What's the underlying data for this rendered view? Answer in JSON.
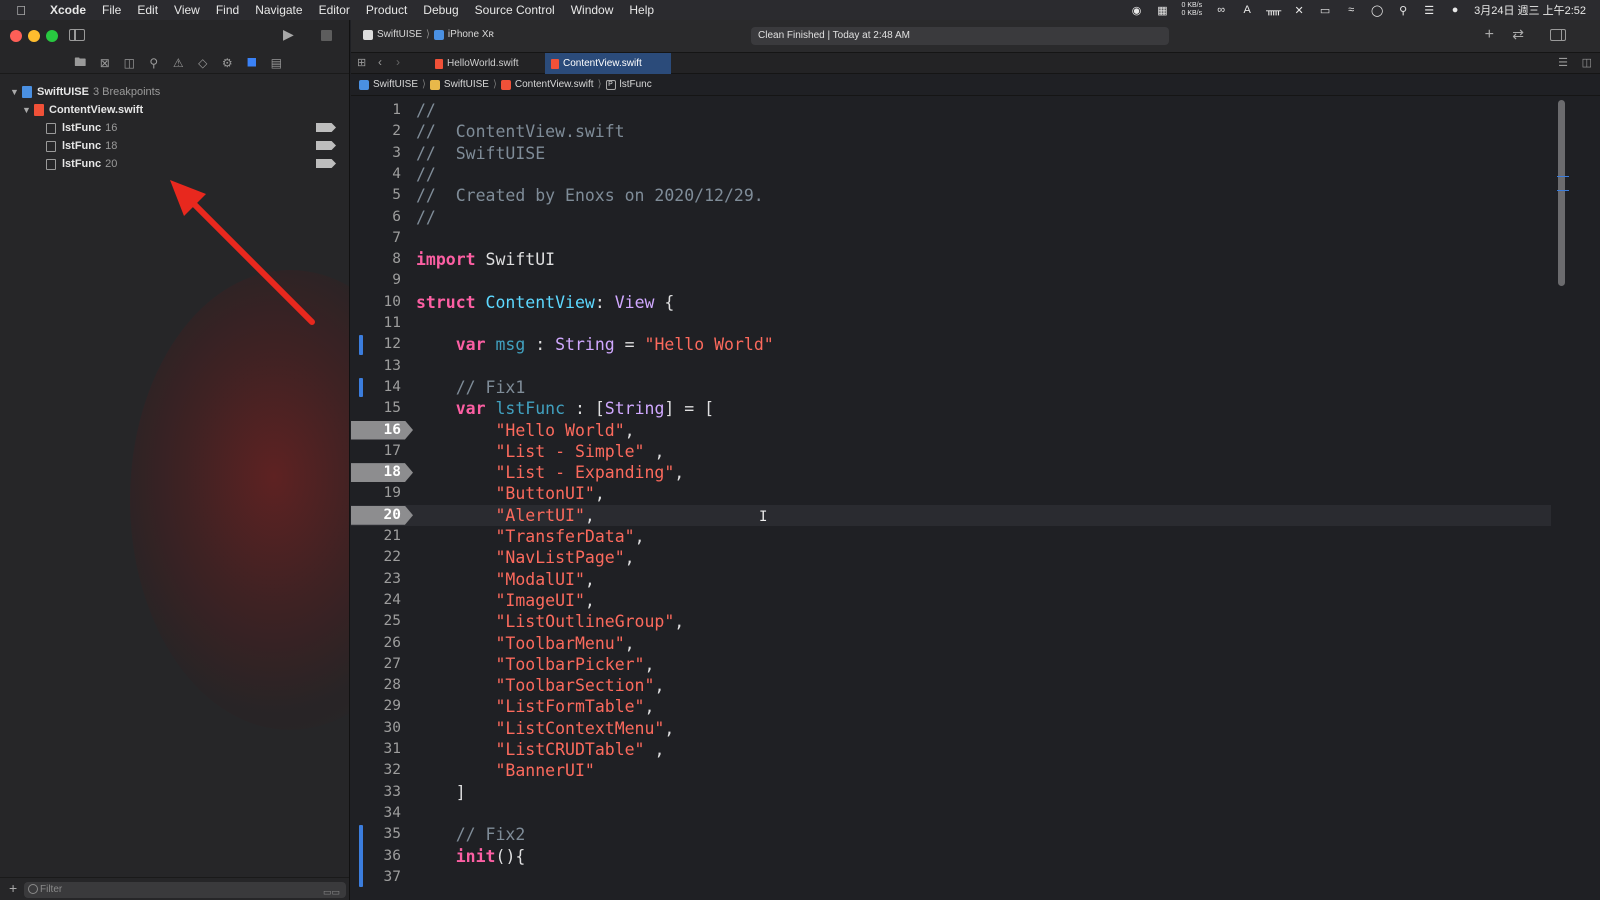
{
  "menubar": {
    "app": "Xcode",
    "items": [
      "File",
      "Edit",
      "View",
      "Find",
      "Navigate",
      "Editor",
      "Product",
      "Debug",
      "Source Control",
      "Window",
      "Help"
    ],
    "net_up": "0 KB/s",
    "net_down": "0 KB/s",
    "clock": "3月24日 週三 上午2:52"
  },
  "navigator": {
    "project": "SwiftUISE",
    "project_note": "3 Breakpoints",
    "file": "ContentView.swift",
    "breakpoints": [
      {
        "name": "lstFunc",
        "line": "16"
      },
      {
        "name": "lstFunc",
        "line": "18"
      },
      {
        "name": "lstFunc",
        "line": "20"
      }
    ],
    "filter_placeholder": "Filter"
  },
  "toolbar": {
    "scheme": "SwiftUISE",
    "device": "iPhone Xʀ",
    "activity": "Clean Finished | Today at 2:48 AM"
  },
  "tabs": [
    "HelloWorld.swift",
    "ContentView.swift"
  ],
  "active_tab": "ContentView.swift",
  "jump_bar": [
    "SwiftUISE",
    "SwiftUISE",
    "ContentView.swift",
    "lstFunc"
  ],
  "breakpoint_lines": [
    16,
    18,
    20
  ],
  "code_lines": [
    "//",
    "//  ContentView.swift",
    "//  SwiftUISE",
    "//",
    "//  Created by Enoxs on 2020/12/29.",
    "//",
    "",
    "import SwiftUI",
    "",
    "struct ContentView: View {",
    "",
    "    var msg : String = \"Hello World\"",
    "",
    "    // Fix1",
    "    var lstFunc : [String] = [",
    "        \"Hello World\",",
    "        \"List - Simple\" ,",
    "        \"List - Expanding\",",
    "        \"ButtonUI\",",
    "        \"AlertUI\",",
    "        \"TransferData\",",
    "        \"NavListPage\",",
    "        \"ModalUI\",",
    "        \"ImageUI\",",
    "        \"ListOutlineGroup\",",
    "        \"ToolbarMenu\",",
    "        \"ToolbarPicker\",",
    "        \"ToolbarSection\",",
    "        \"ListFormTable\",",
    "        \"ListContextMenu\",",
    "        \"ListCRUDTable\" ,",
    "        \"BannerUI\"",
    "    ]",
    "",
    "    // Fix2",
    "    init(){",
    ""
  ],
  "colors": {
    "annotation_arrow": "#e8281e",
    "breakpoint": "#8d8d8f",
    "accent": "#3a82f7"
  }
}
